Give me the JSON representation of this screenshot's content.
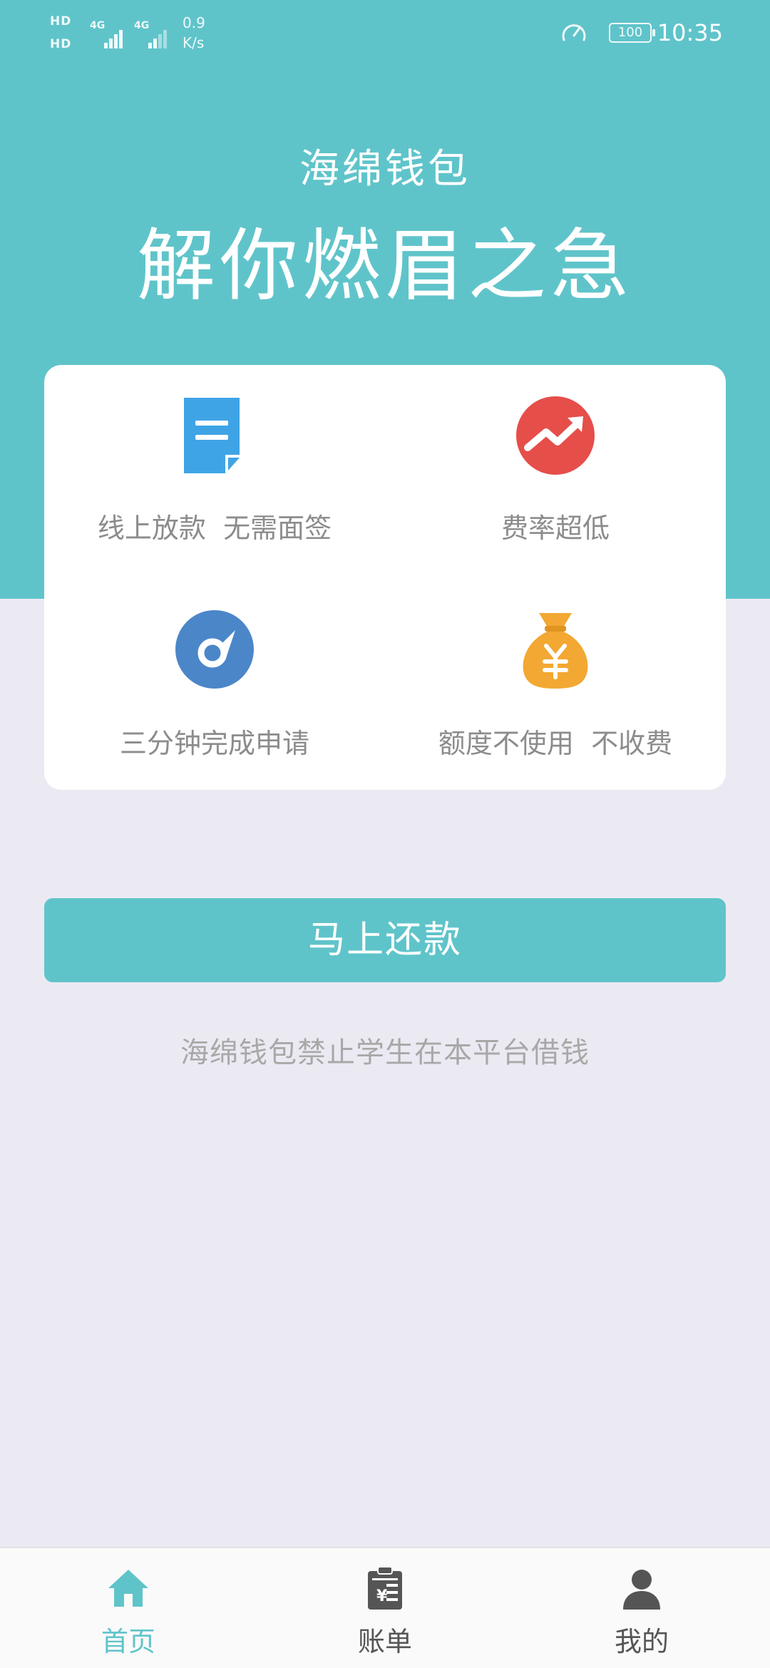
{
  "status_bar": {
    "hd1": "HD",
    "hd2": "HD",
    "net1": "4G",
    "net2": "4G",
    "speed_value": "0.9",
    "speed_unit": "K/s",
    "battery": "100",
    "time": "10:35"
  },
  "header": {
    "app_name": "海绵钱包",
    "slogan": "解你燃眉之急"
  },
  "features": [
    {
      "label": "线上放款  无需面签",
      "icon": "document-icon",
      "color": "#3fa4e6"
    },
    {
      "label": "费率超低",
      "icon": "trend-up-icon",
      "color": "#e64e4a"
    },
    {
      "label": "三分钟完成申请",
      "icon": "gauge-icon",
      "color": "#4b86c9"
    },
    {
      "label": "额度不使用  不收费",
      "icon": "money-bag-icon",
      "color": "#f2a832"
    }
  ],
  "repay_button": {
    "label": "马上还款"
  },
  "notice": "海绵钱包禁止学生在本平台借钱",
  "bottom_nav": [
    {
      "label": "首页",
      "icon": "home-icon",
      "active": true
    },
    {
      "label": "账单",
      "icon": "bill-icon",
      "active": false
    },
    {
      "label": "我的",
      "icon": "user-icon",
      "active": false
    }
  ],
  "colors": {
    "brand": "#5fc4ca",
    "background": "#ebeaf3",
    "card": "#ffffff",
    "feature_text": "#8c8c8c",
    "notice_text": "#a8a8a8"
  }
}
